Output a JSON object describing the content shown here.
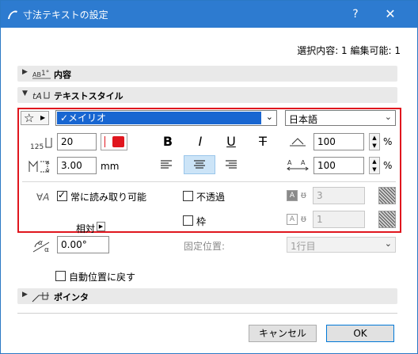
{
  "window": {
    "title": "寸法テキストの設定",
    "help_label": "?",
    "close_label": "✕"
  },
  "selection_info": "選択内容: 1 編集可能: 1",
  "sections": {
    "contents": {
      "label": "内容"
    },
    "text_style": {
      "label": "テキストスタイル"
    },
    "pointer": {
      "label": "ポインタ"
    }
  },
  "text_style": {
    "font_name": "✓メイリオ",
    "language": "日本語",
    "font_size": "20",
    "width_factor": "100",
    "spacing_factor": "100",
    "percent": "%",
    "pen_height": "3.00",
    "unit": "mm",
    "bold_label": "B",
    "italic_label": "I",
    "underline_label": "U",
    "strikethrough_label": "T",
    "always_readable_label": "常に読み取り可能",
    "always_readable_checked": true,
    "opaque_label": "不透過",
    "opaque_checked": false,
    "frame_label": "枠",
    "frame_checked": false,
    "relative_label": "相対",
    "pen_a": "3",
    "pen_b": "1",
    "text_color": "#e0161e"
  },
  "placement": {
    "angle": "0.00°",
    "fixed_position_label": "固定位置:",
    "fixed_position_value": "1行目"
  },
  "auto_reposition_label": "自動位置に戻す",
  "buttons": {
    "cancel": "キャンセル",
    "ok": "OK"
  },
  "colors": {
    "titlebar": "#2d7bd0",
    "highlight": "#e0161e",
    "selection": "#1866d1"
  }
}
